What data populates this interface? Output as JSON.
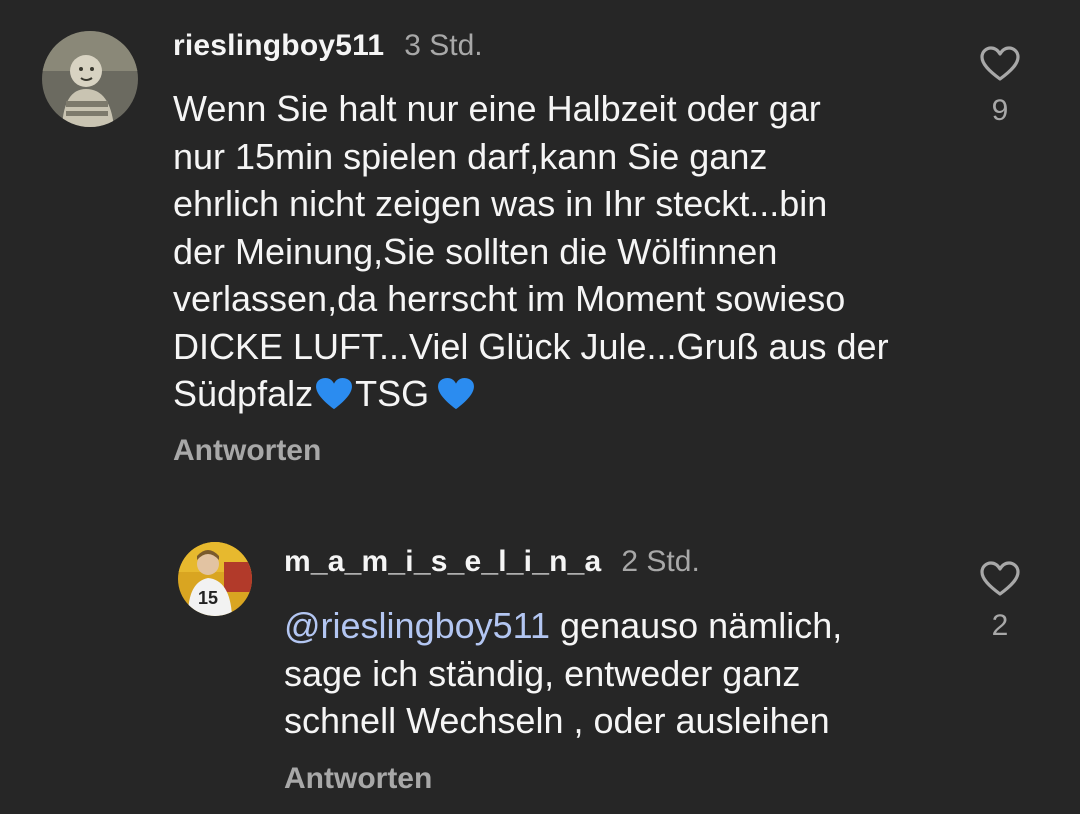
{
  "comments": [
    {
      "username": "rieslingboy511",
      "time": "3 Std.",
      "lines": [
        "Wenn Sie halt nur eine Halbzeit oder gar",
        "nur 15min spielen darf,kann Sie ganz",
        "ehrlich nicht zeigen was in Ihr steckt...bin",
        "der Meinung,Sie sollten die Wölfinnen",
        "verlassen,da herrscht im Moment sowieso",
        "DICKE LUFT...Viel Glück Jule...Gruß aus der"
      ],
      "last_line_a": "Südpfalz ",
      "last_line_b": "TSG ",
      "emoji": "💙",
      "reply_label": "Antworten",
      "likes": "9"
    },
    {
      "username": "m_a_m_i_s_e_l_i_n_a",
      "time": "2 Std.",
      "mention": "@rieslingboy511",
      "first_line_rest": " genauso nämlich,",
      "lines": [
        "sage ich ständig, entweder ganz",
        "schnell Wechseln , oder ausleihen"
      ],
      "reply_label": "Antworten",
      "likes": "2"
    }
  ],
  "colors": {
    "background": "#262626",
    "text": "#f5f5f5",
    "secondary": "#a8a8a8",
    "mention": "#b3c6f2",
    "heart_emoji": "#2b8cf0"
  },
  "icons": {
    "like": "heart-outline-icon",
    "emoji": "blue-heart-icon"
  }
}
